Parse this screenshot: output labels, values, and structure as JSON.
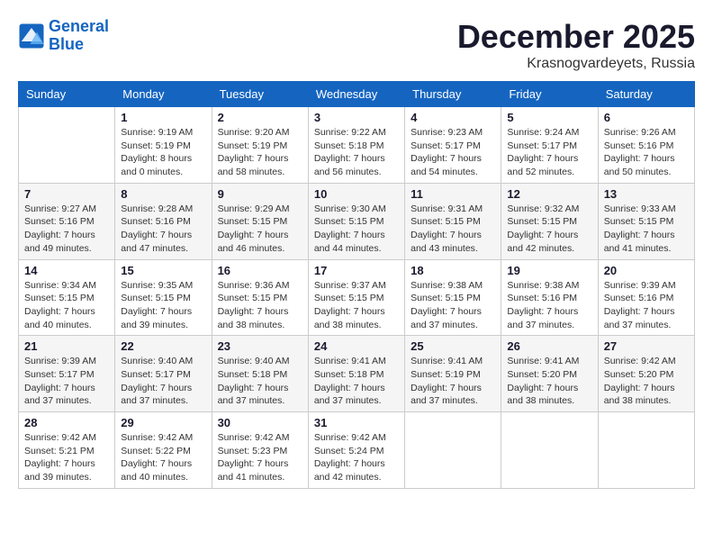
{
  "logo": {
    "line1": "General",
    "line2": "Blue"
  },
  "title": {
    "month_year": "December 2025",
    "location": "Krasnogvardeyets, Russia"
  },
  "headers": [
    "Sunday",
    "Monday",
    "Tuesday",
    "Wednesday",
    "Thursday",
    "Friday",
    "Saturday"
  ],
  "weeks": [
    [
      {
        "day": "",
        "info": ""
      },
      {
        "day": "1",
        "info": "Sunrise: 9:19 AM\nSunset: 5:19 PM\nDaylight: 8 hours\nand 0 minutes."
      },
      {
        "day": "2",
        "info": "Sunrise: 9:20 AM\nSunset: 5:19 PM\nDaylight: 7 hours\nand 58 minutes."
      },
      {
        "day": "3",
        "info": "Sunrise: 9:22 AM\nSunset: 5:18 PM\nDaylight: 7 hours\nand 56 minutes."
      },
      {
        "day": "4",
        "info": "Sunrise: 9:23 AM\nSunset: 5:17 PM\nDaylight: 7 hours\nand 54 minutes."
      },
      {
        "day": "5",
        "info": "Sunrise: 9:24 AM\nSunset: 5:17 PM\nDaylight: 7 hours\nand 52 minutes."
      },
      {
        "day": "6",
        "info": "Sunrise: 9:26 AM\nSunset: 5:16 PM\nDaylight: 7 hours\nand 50 minutes."
      }
    ],
    [
      {
        "day": "7",
        "info": "Sunrise: 9:27 AM\nSunset: 5:16 PM\nDaylight: 7 hours\nand 49 minutes."
      },
      {
        "day": "8",
        "info": "Sunrise: 9:28 AM\nSunset: 5:16 PM\nDaylight: 7 hours\nand 47 minutes."
      },
      {
        "day": "9",
        "info": "Sunrise: 9:29 AM\nSunset: 5:15 PM\nDaylight: 7 hours\nand 46 minutes."
      },
      {
        "day": "10",
        "info": "Sunrise: 9:30 AM\nSunset: 5:15 PM\nDaylight: 7 hours\nand 44 minutes."
      },
      {
        "day": "11",
        "info": "Sunrise: 9:31 AM\nSunset: 5:15 PM\nDaylight: 7 hours\nand 43 minutes."
      },
      {
        "day": "12",
        "info": "Sunrise: 9:32 AM\nSunset: 5:15 PM\nDaylight: 7 hours\nand 42 minutes."
      },
      {
        "day": "13",
        "info": "Sunrise: 9:33 AM\nSunset: 5:15 PM\nDaylight: 7 hours\nand 41 minutes."
      }
    ],
    [
      {
        "day": "14",
        "info": "Sunrise: 9:34 AM\nSunset: 5:15 PM\nDaylight: 7 hours\nand 40 minutes."
      },
      {
        "day": "15",
        "info": "Sunrise: 9:35 AM\nSunset: 5:15 PM\nDaylight: 7 hours\nand 39 minutes."
      },
      {
        "day": "16",
        "info": "Sunrise: 9:36 AM\nSunset: 5:15 PM\nDaylight: 7 hours\nand 38 minutes."
      },
      {
        "day": "17",
        "info": "Sunrise: 9:37 AM\nSunset: 5:15 PM\nDaylight: 7 hours\nand 38 minutes."
      },
      {
        "day": "18",
        "info": "Sunrise: 9:38 AM\nSunset: 5:15 PM\nDaylight: 7 hours\nand 37 minutes."
      },
      {
        "day": "19",
        "info": "Sunrise: 9:38 AM\nSunset: 5:16 PM\nDaylight: 7 hours\nand 37 minutes."
      },
      {
        "day": "20",
        "info": "Sunrise: 9:39 AM\nSunset: 5:16 PM\nDaylight: 7 hours\nand 37 minutes."
      }
    ],
    [
      {
        "day": "21",
        "info": "Sunrise: 9:39 AM\nSunset: 5:17 PM\nDaylight: 7 hours\nand 37 minutes."
      },
      {
        "day": "22",
        "info": "Sunrise: 9:40 AM\nSunset: 5:17 PM\nDaylight: 7 hours\nand 37 minutes."
      },
      {
        "day": "23",
        "info": "Sunrise: 9:40 AM\nSunset: 5:18 PM\nDaylight: 7 hours\nand 37 minutes."
      },
      {
        "day": "24",
        "info": "Sunrise: 9:41 AM\nSunset: 5:18 PM\nDaylight: 7 hours\nand 37 minutes."
      },
      {
        "day": "25",
        "info": "Sunrise: 9:41 AM\nSunset: 5:19 PM\nDaylight: 7 hours\nand 37 minutes."
      },
      {
        "day": "26",
        "info": "Sunrise: 9:41 AM\nSunset: 5:20 PM\nDaylight: 7 hours\nand 38 minutes."
      },
      {
        "day": "27",
        "info": "Sunrise: 9:42 AM\nSunset: 5:20 PM\nDaylight: 7 hours\nand 38 minutes."
      }
    ],
    [
      {
        "day": "28",
        "info": "Sunrise: 9:42 AM\nSunset: 5:21 PM\nDaylight: 7 hours\nand 39 minutes."
      },
      {
        "day": "29",
        "info": "Sunrise: 9:42 AM\nSunset: 5:22 PM\nDaylight: 7 hours\nand 40 minutes."
      },
      {
        "day": "30",
        "info": "Sunrise: 9:42 AM\nSunset: 5:23 PM\nDaylight: 7 hours\nand 41 minutes."
      },
      {
        "day": "31",
        "info": "Sunrise: 9:42 AM\nSunset: 5:24 PM\nDaylight: 7 hours\nand 42 minutes."
      },
      {
        "day": "",
        "info": ""
      },
      {
        "day": "",
        "info": ""
      },
      {
        "day": "",
        "info": ""
      }
    ]
  ]
}
